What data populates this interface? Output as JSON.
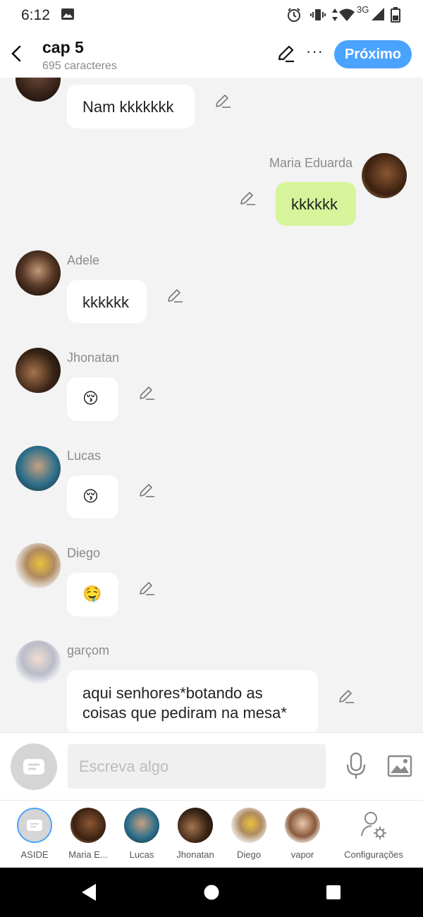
{
  "status": {
    "time": "6:12",
    "network": "3G"
  },
  "header": {
    "title": "cap 5",
    "subtitle": "695 caracteres",
    "next_label": "Próximo"
  },
  "messages": [
    {
      "name": "",
      "text": "Nam kkkkkkk"
    },
    {
      "name": "Maria Eduarda",
      "text": "kkkkkk"
    },
    {
      "name": "Adele",
      "text": "kkkkkk"
    },
    {
      "name": "Jhonatan",
      "text": "😚"
    },
    {
      "name": "Lucas",
      "text": "😚"
    },
    {
      "name": "Diego",
      "text": "🤤"
    },
    {
      "name": "garçom",
      "text_line1": "aqui senhores*botando as",
      "text_line2": "coisas que pediram na mesa*"
    }
  ],
  "composer": {
    "placeholder": "Escreva algo"
  },
  "characters": [
    {
      "label": "ASIDE"
    },
    {
      "label": "Maria E..."
    },
    {
      "label": "Lucas"
    },
    {
      "label": "Jhonatan"
    },
    {
      "label": "Diego"
    },
    {
      "label": "vapor"
    },
    {
      "label": "Configurações"
    }
  ],
  "colors": {
    "accent": "#4aa3ff",
    "own_bubble": "#d6f59a",
    "other_bubble": "#ffffff",
    "chat_bg": "#f3f3f3"
  },
  "icons": [
    "back-icon",
    "pen-icon",
    "more-icon",
    "edit-icon",
    "mic-icon",
    "image-icon",
    "settings-icon",
    "nav-back-icon",
    "nav-home-icon",
    "nav-recents-icon"
  ]
}
